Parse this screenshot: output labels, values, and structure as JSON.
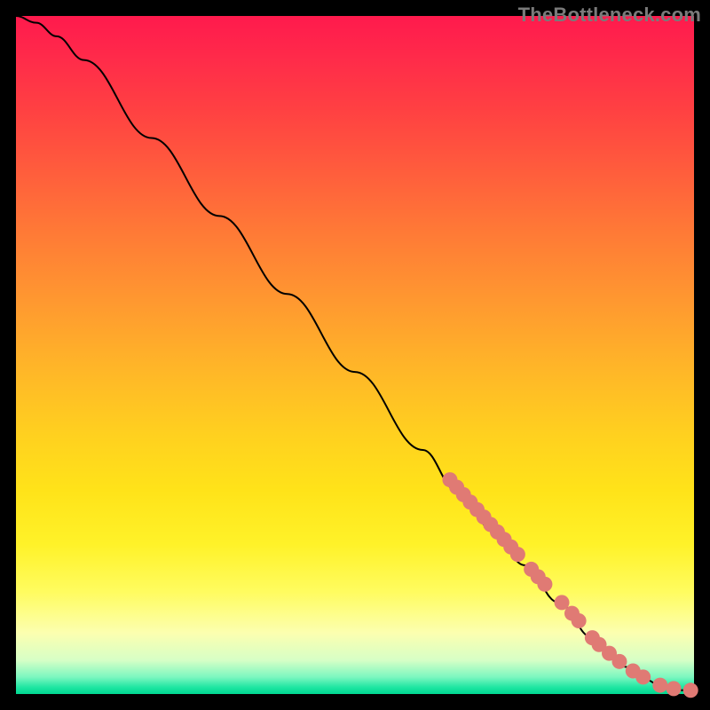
{
  "watermark": "TheBottleneck.com",
  "chart_data": {
    "type": "line",
    "title": "",
    "xlabel": "",
    "ylabel": "",
    "xlim": [
      0,
      100
    ],
    "ylim": [
      0,
      100
    ],
    "grid": false,
    "series": [
      {
        "name": "curve",
        "kind": "line",
        "x": [
          0,
          3,
          6,
          10,
          20,
          30,
          40,
          50,
          60,
          65,
          70,
          75,
          80,
          85,
          90,
          93,
          95,
          97,
          98.5,
          100
        ],
        "y": [
          100,
          99,
          97,
          93.5,
          82,
          70.5,
          59,
          47.5,
          36,
          30,
          24.5,
          19,
          13.5,
          8.3,
          4,
          2.1,
          1.2,
          0.7,
          0.55,
          0.5
        ]
      },
      {
        "name": "points",
        "kind": "scatter",
        "x": [
          64,
          65,
          66,
          67,
          68,
          69,
          70,
          71,
          72,
          73,
          74,
          76,
          77,
          78,
          80.5,
          82,
          83,
          85,
          86,
          87.5,
          89,
          91,
          92.5,
          95,
          97,
          99.5
        ],
        "y": [
          31.6,
          30.5,
          29.4,
          28.3,
          27.2,
          26.1,
          25.0,
          23.9,
          22.8,
          21.7,
          20.6,
          18.4,
          17.3,
          16.2,
          13.5,
          11.9,
          10.8,
          8.3,
          7.3,
          6.0,
          4.8,
          3.4,
          2.5,
          1.3,
          0.8,
          0.55
        ]
      }
    ]
  }
}
